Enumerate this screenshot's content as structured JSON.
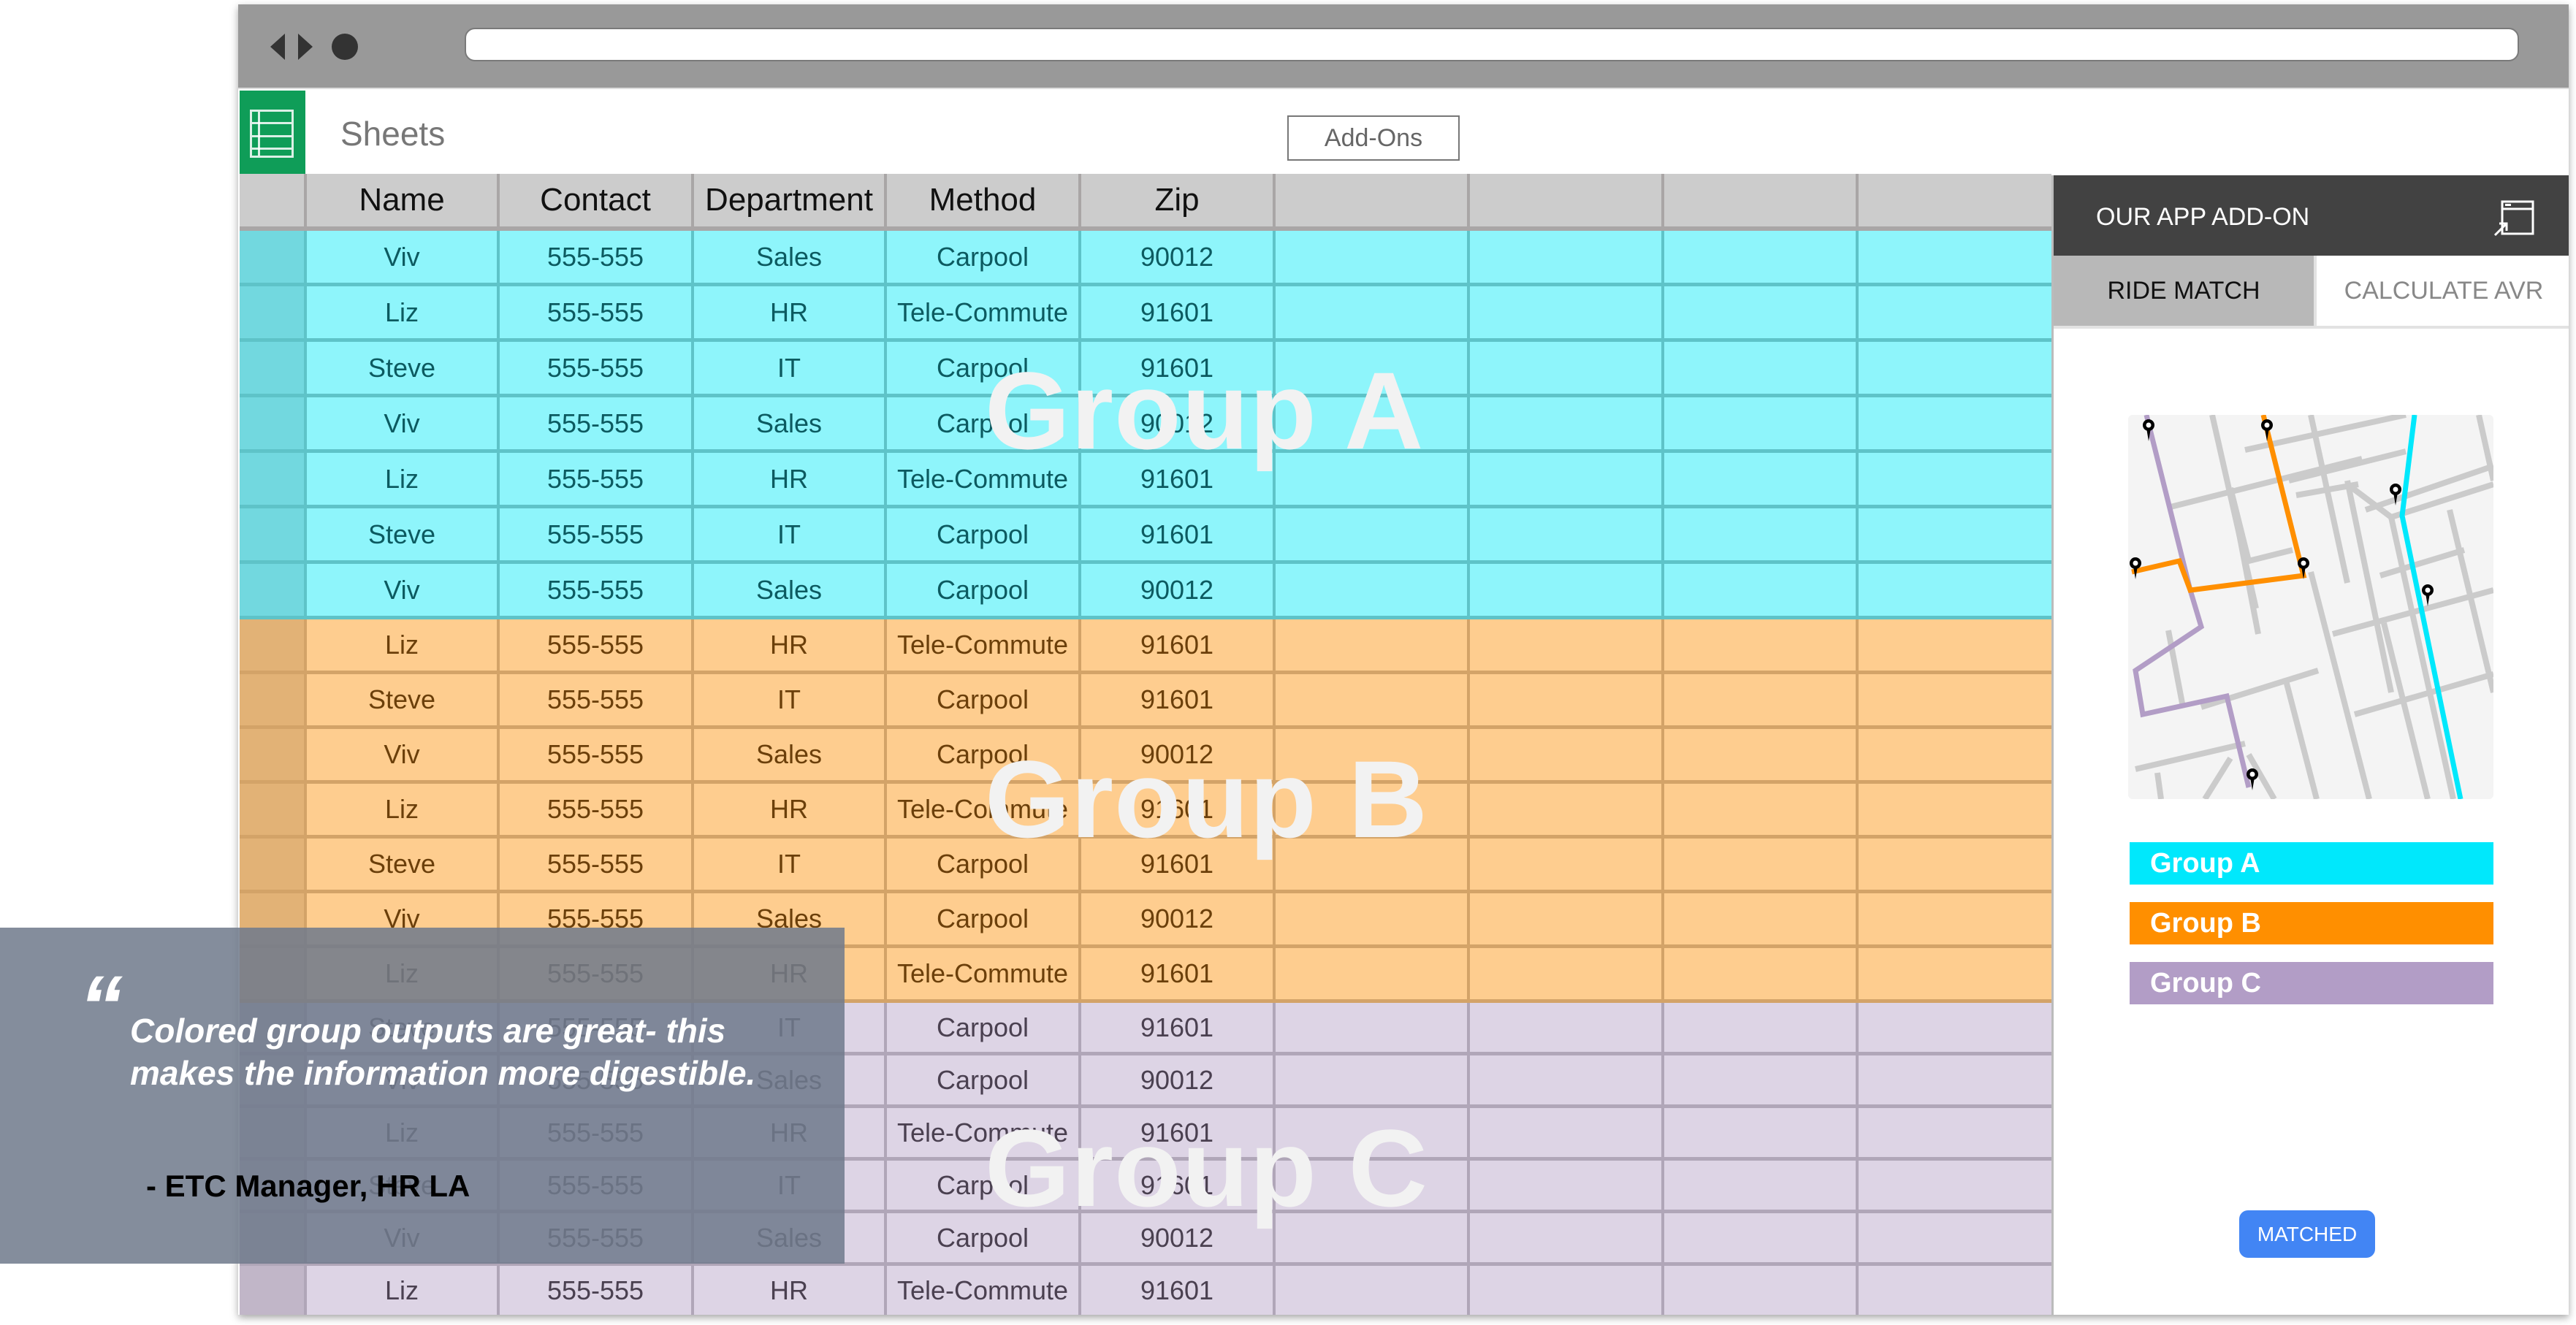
{
  "browser": {
    "address_value": ""
  },
  "app": {
    "title": "Sheets",
    "addons_label": "Add-Ons"
  },
  "table": {
    "headers": [
      "Name",
      "Contact",
      "Department",
      "Method",
      "Zip"
    ],
    "groups": [
      {
        "label": "Group A",
        "color": "#8ef5fb",
        "rows": [
          [
            "Viv",
            "555-555",
            "Sales",
            "Carpool",
            "90012"
          ],
          [
            "Liz",
            "555-555",
            "HR",
            "Tele-Commute",
            "91601"
          ],
          [
            "Steve",
            "555-555",
            "IT",
            "Carpool",
            "91601"
          ],
          [
            "Viv",
            "555-555",
            "Sales",
            "Carpool",
            "90012"
          ],
          [
            "Liz",
            "555-555",
            "HR",
            "Tele-Commute",
            "91601"
          ],
          [
            "Steve",
            "555-555",
            "IT",
            "Carpool",
            "91601"
          ],
          [
            "Viv",
            "555-555",
            "Sales",
            "Carpool",
            "90012"
          ]
        ]
      },
      {
        "label": "Group B",
        "color": "#fecd8f",
        "rows": [
          [
            "Liz",
            "555-555",
            "HR",
            "Tele-Commute",
            "91601"
          ],
          [
            "Steve",
            "555-555",
            "IT",
            "Carpool",
            "91601"
          ],
          [
            "Viv",
            "555-555",
            "Sales",
            "Carpool",
            "90012"
          ],
          [
            "Liz",
            "555-555",
            "HR",
            "Tele-Commute",
            "91601"
          ],
          [
            "Steve",
            "555-555",
            "IT",
            "Carpool",
            "91601"
          ],
          [
            "Viv",
            "555-555",
            "Sales",
            "Carpool",
            "90012"
          ],
          [
            "Liz",
            "555-555",
            "HR",
            "Tele-Commute",
            "91601"
          ]
        ]
      },
      {
        "label": "Group C",
        "color": "#ddd4e5",
        "rows": [
          [
            "Steve",
            "555-555",
            "IT",
            "Carpool",
            "91601"
          ],
          [
            "Viv",
            "555-555",
            "Sales",
            "Carpool",
            "90012"
          ],
          [
            "Liz",
            "555-555",
            "HR",
            "Tele-Commute",
            "91601"
          ],
          [
            "Steve",
            "555-555",
            "IT",
            "Carpool",
            "91601"
          ],
          [
            "Viv",
            "555-555",
            "Sales",
            "Carpool",
            "90012"
          ],
          [
            "Liz",
            "555-555",
            "HR",
            "Tele-Commute",
            "91601"
          ]
        ]
      }
    ]
  },
  "panel": {
    "title": "OUR APP ADD-ON",
    "popout_icon": "popout-window-icon",
    "tabs": [
      {
        "label": "RIDE MATCH",
        "active": true
      },
      {
        "label": "CALCULATE AVR",
        "active": false
      }
    ],
    "map_icon": "route-map",
    "legend": [
      {
        "label": "Group A",
        "color": "#00e8fc"
      },
      {
        "label": "Group B",
        "color": "#ff8f00"
      },
      {
        "label": "Group C",
        "color": "#b29dc6"
      }
    ],
    "matched_label": "MATCHED",
    "matched_color": "#4285f4"
  },
  "quote": {
    "mark": "“",
    "text": "Colored group outputs are great- this makes the information more digestible.",
    "author": "- ETC Manager, HR LA"
  }
}
